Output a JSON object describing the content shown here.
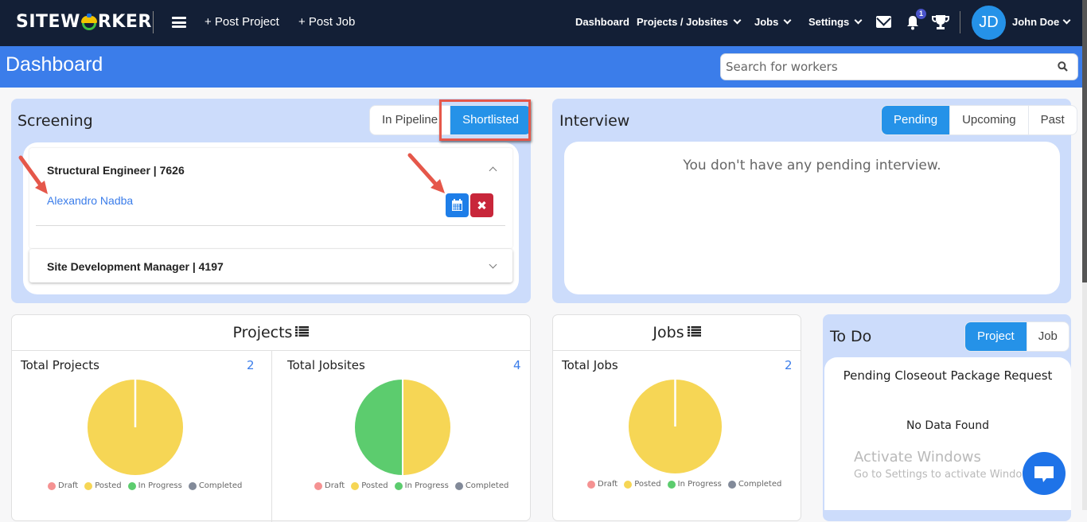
{
  "topbar": {
    "logo": {
      "pre": "SITEW",
      "post": "RKER"
    },
    "post_project": "+ Post Project",
    "post_job": "+ Post Job",
    "nav": [
      {
        "label": "Dashboard",
        "dropdown": false
      },
      {
        "label": "Projects / Jobsites",
        "dropdown": true
      },
      {
        "label": "Jobs",
        "dropdown": true
      },
      {
        "label": "Settings",
        "dropdown": true
      }
    ],
    "notification_count": "1",
    "avatar_initials": "JD",
    "username": "John Doe"
  },
  "header": {
    "title": "Dashboard",
    "search_placeholder": "Search for workers",
    "search_value": ""
  },
  "screening": {
    "title": "Screening",
    "tabs": [
      {
        "label": "In Pipeline",
        "active": false
      },
      {
        "label": "Shortlisted",
        "active": true
      }
    ],
    "jobs": [
      {
        "title": "Structural Engineer | 7626",
        "expanded": true,
        "workers": [
          {
            "name": "Alexandro Nadba"
          }
        ]
      },
      {
        "title": "Site Development Manager | 4197",
        "expanded": false,
        "workers": []
      }
    ]
  },
  "interview": {
    "title": "Interview",
    "tabs": [
      {
        "label": "Pending",
        "active": true
      },
      {
        "label": "Upcoming",
        "active": false
      },
      {
        "label": "Past",
        "active": false
      }
    ],
    "empty_message": "You don't have any pending interview."
  },
  "projects_card": {
    "title": "Projects",
    "stats": [
      {
        "label": "Total Projects",
        "value": "2"
      },
      {
        "label": "Total Jobsites",
        "value": "4"
      }
    ]
  },
  "jobs_card": {
    "title": "Jobs",
    "stats": [
      {
        "label": "Total Jobs",
        "value": "2"
      }
    ]
  },
  "todo": {
    "title": "To Do",
    "tabs": [
      {
        "label": "Project",
        "active": true
      },
      {
        "label": "Job",
        "active": false
      }
    ],
    "section_title": "Pending Closeout Package Request",
    "empty_message": "No Data Found"
  },
  "watermark": {
    "line1": "Activate Windows",
    "line2": "Go to Settings to activate Windows."
  },
  "colors": {
    "navbar": "#131f36",
    "accent_blue": "#3b7dea",
    "button_blue": "#2592e8",
    "panel_bg": "#ccdcfb",
    "danger": "#c8263a",
    "annotation": "#e5574a"
  },
  "chart_data": [
    {
      "type": "pie",
      "title": "Total Projects",
      "categories": [
        "Draft",
        "Posted",
        "In Progress",
        "Completed"
      ],
      "values": [
        0,
        2,
        0,
        0
      ],
      "colors": [
        "#f59292",
        "#f6d655",
        "#5ccc6e",
        "#828a99"
      ],
      "legend": "bottom"
    },
    {
      "type": "pie",
      "title": "Total Jobsites",
      "categories": [
        "Draft",
        "Posted",
        "In Progress",
        "Completed"
      ],
      "values": [
        0,
        2,
        2,
        0
      ],
      "colors": [
        "#f59292",
        "#f6d655",
        "#5ccc6e",
        "#828a99"
      ],
      "legend": "bottom"
    },
    {
      "type": "pie",
      "title": "Total Jobs",
      "categories": [
        "Draft",
        "Posted",
        "In Progress",
        "Completed"
      ],
      "values": [
        0,
        2,
        0,
        0
      ],
      "colors": [
        "#f59292",
        "#f6d655",
        "#5ccc6e",
        "#828a99"
      ],
      "legend": "bottom"
    }
  ]
}
